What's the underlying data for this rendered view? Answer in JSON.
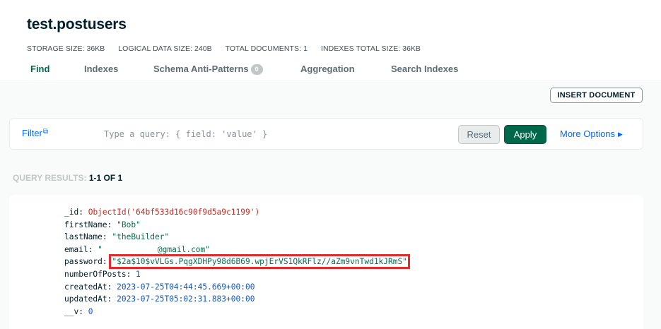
{
  "collection": {
    "name": "test.postusers",
    "stats": [
      {
        "label": "STORAGE SIZE:",
        "value": "36KB"
      },
      {
        "label": "LOGICAL DATA SIZE:",
        "value": "240B"
      },
      {
        "label": "TOTAL DOCUMENTS:",
        "value": "1"
      },
      {
        "label": "INDEXES TOTAL SIZE:",
        "value": "36KB"
      }
    ]
  },
  "tabs": [
    {
      "label": "Find",
      "active": true
    },
    {
      "label": "Indexes"
    },
    {
      "label": "Schema Anti-Patterns",
      "badge": "0"
    },
    {
      "label": "Aggregation"
    },
    {
      "label": "Search Indexes"
    }
  ],
  "toolbar": {
    "insert_label": "INSERT DOCUMENT"
  },
  "filter": {
    "label": "Filter",
    "placeholder": "Type a query: { field: 'value' }",
    "reset_label": "Reset",
    "apply_label": "Apply",
    "more_options_label": "More Options"
  },
  "results": {
    "label": "QUERY RESULTS:",
    "range": "1-1 OF 1"
  },
  "document": {
    "fields": [
      {
        "key": "_id",
        "value": "ObjectId('64bf533d16c90f9d5a9c1199')",
        "type": "oid"
      },
      {
        "key": "firstName",
        "value": "\"Bob\"",
        "type": "str"
      },
      {
        "key": "lastName",
        "value": "\"theBuilder\"",
        "type": "str"
      },
      {
        "key": "email",
        "value_start": "\"",
        "value_end": "@gmail.com\"",
        "type": "str"
      },
      {
        "key": "password",
        "value": "\"$2a$10$vVLGs.PqgXDHPy98d6B69.wpjErVS1QkRFlz//aZm9vnTwd1kJRmS\"",
        "type": "str",
        "highlighted": true
      },
      {
        "key": "numberOfPosts",
        "value": "1",
        "type": "num"
      },
      {
        "key": "createdAt",
        "value": "2023-07-25T04:44:45.669+00:00",
        "type": "date"
      },
      {
        "key": "updatedAt",
        "value": "2023-07-25T05:02:31.883+00:00",
        "type": "date"
      },
      {
        "key": "__v",
        "value": "0",
        "type": "num"
      }
    ]
  },
  "colors": {
    "accent_green": "#00684a",
    "link_blue": "#016bf8",
    "highlight_red": "#e22c2c",
    "objectid_red": "#c52a20",
    "string_green": "#0b6b4e",
    "number_blue": "#1254b7"
  },
  "icons": {
    "filter_link": "external-link-icon",
    "more_options": "caret-right-icon"
  }
}
